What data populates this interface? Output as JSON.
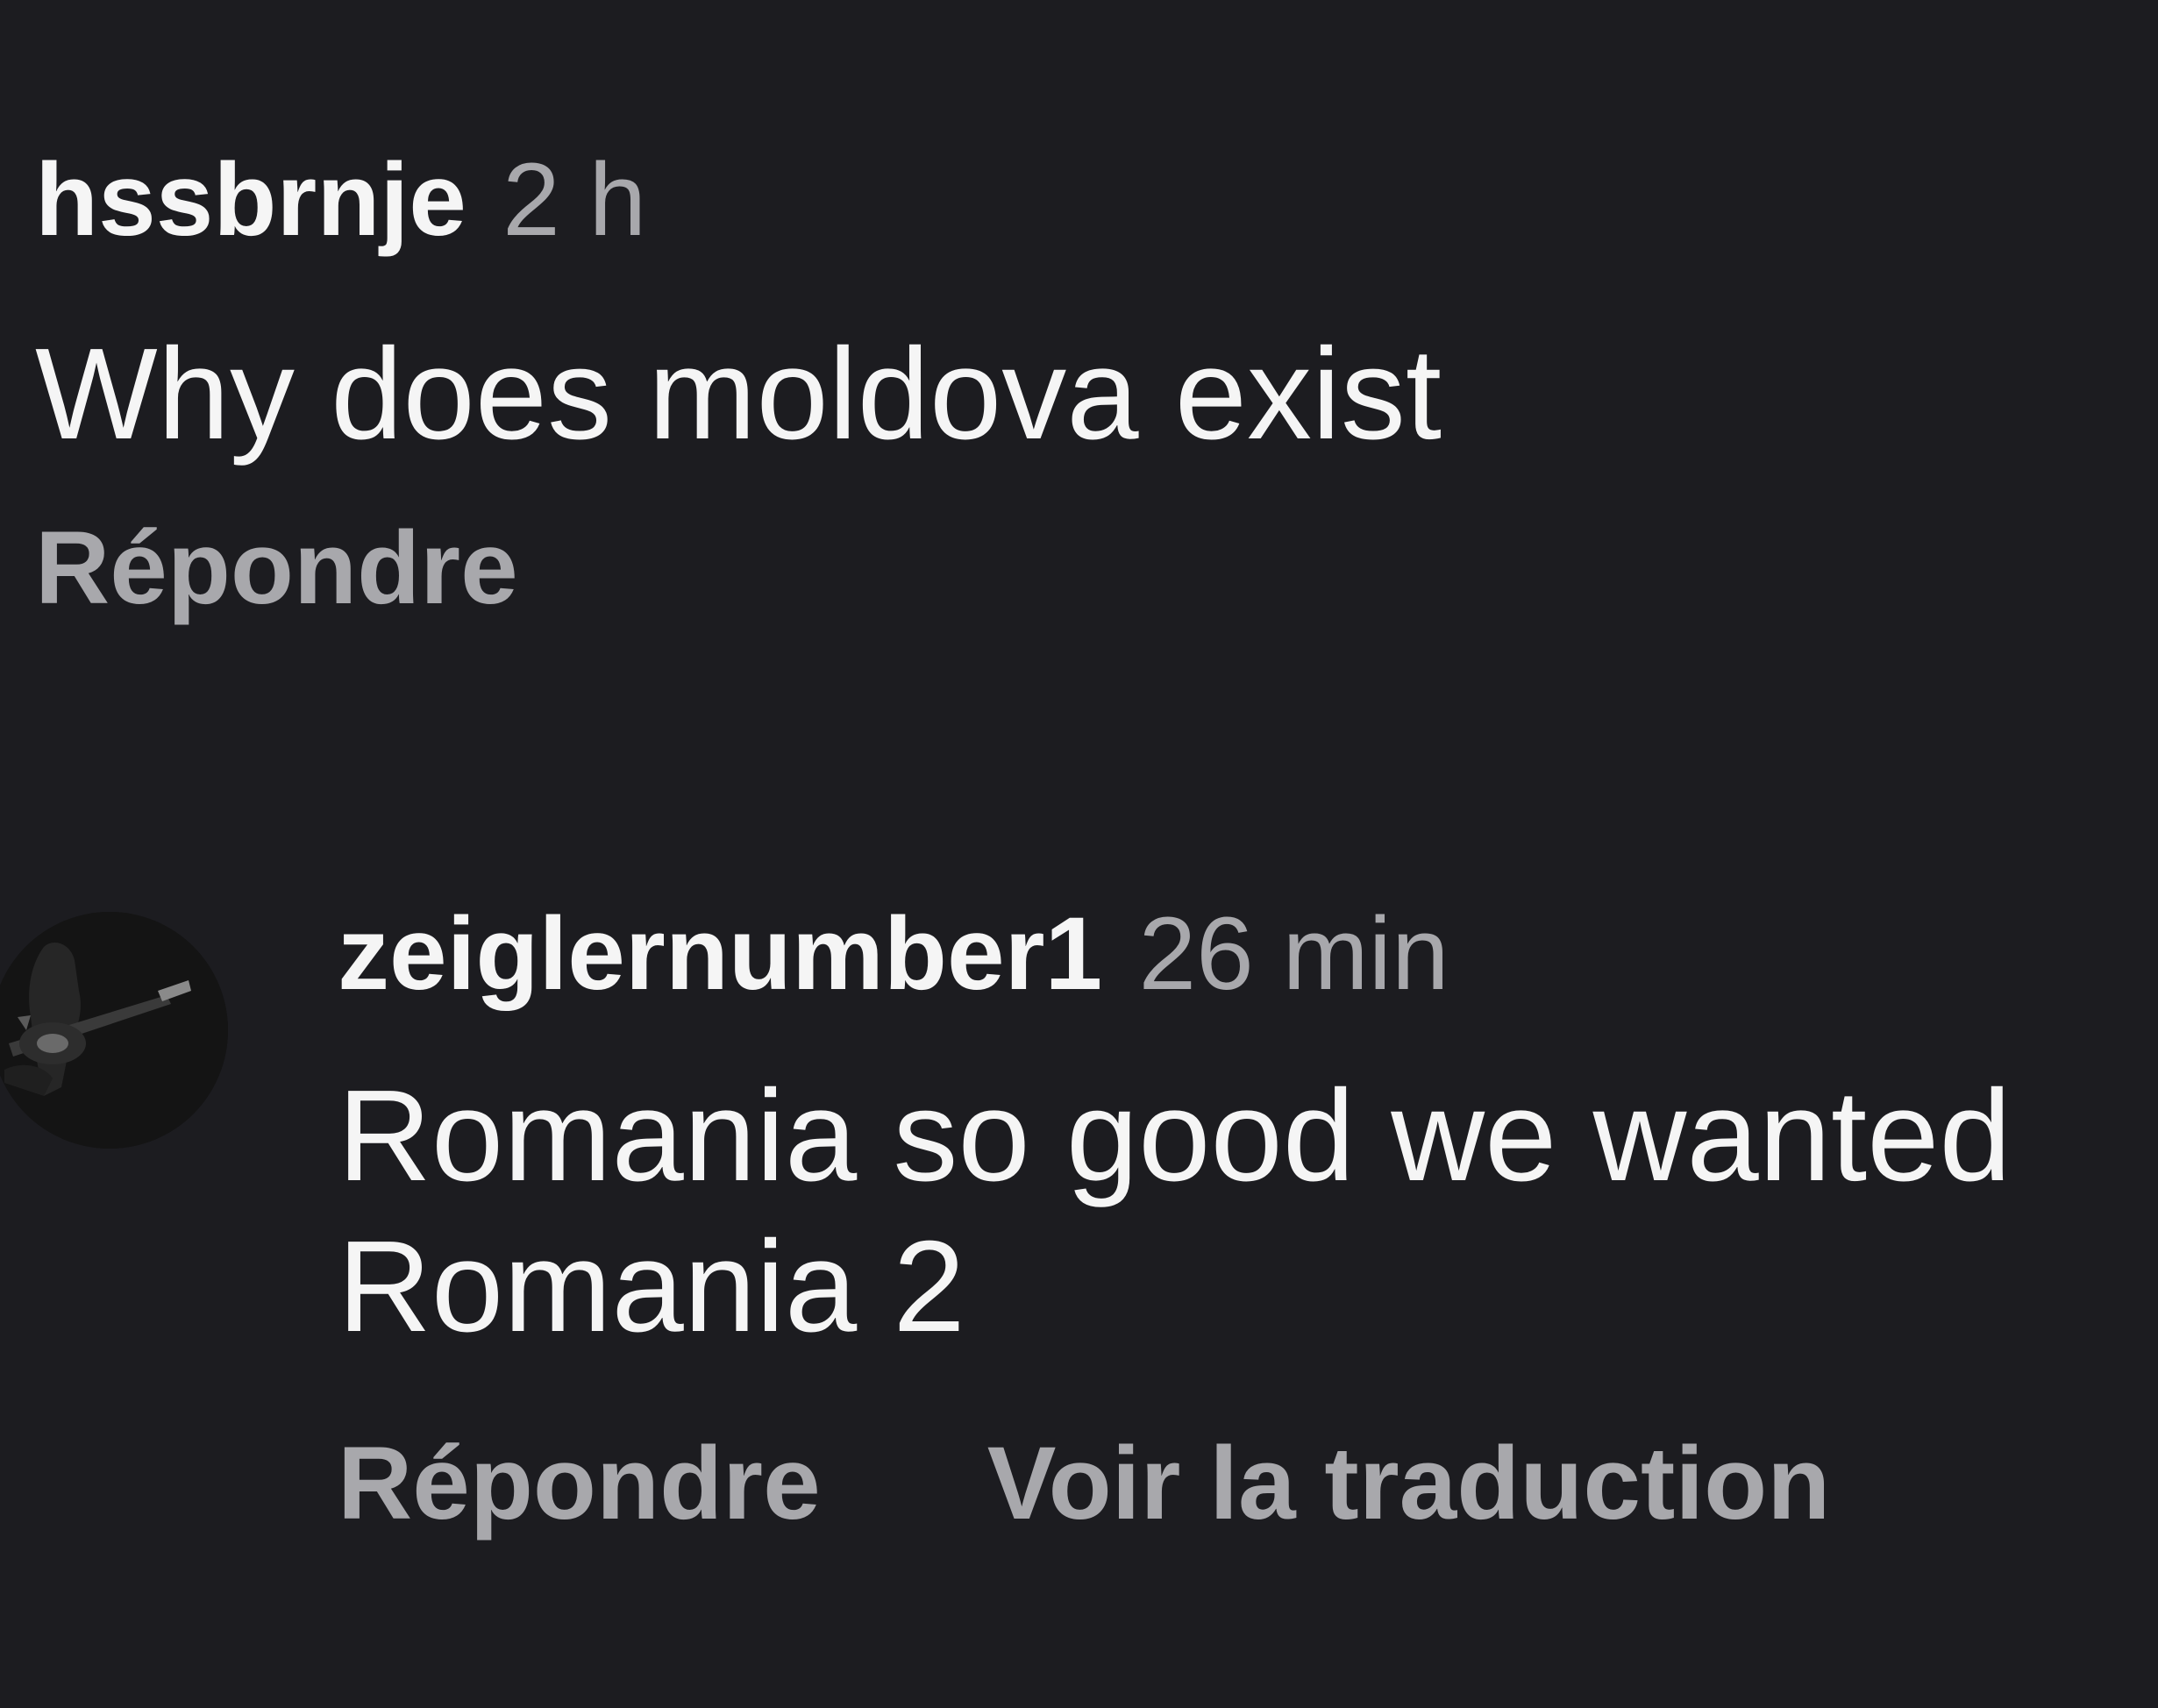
{
  "comments": [
    {
      "username": "hssbrnje",
      "time": "2 h",
      "text": "Why does moldova exist",
      "reply_label": "Répondre"
    },
    {
      "username": "zeiglernumber1",
      "time": "26 min",
      "text_line1": "Romania so good we wanted",
      "text_line2": "Romania 2",
      "reply_label": "Répondre",
      "translate_label": "Voir la traduction",
      "avatar_icon": "guitarist-photo-avatar"
    }
  ],
  "colors": {
    "background": "#1c1c20",
    "primary_text": "#f5f5f5",
    "secondary_text": "#a8a8ac"
  }
}
